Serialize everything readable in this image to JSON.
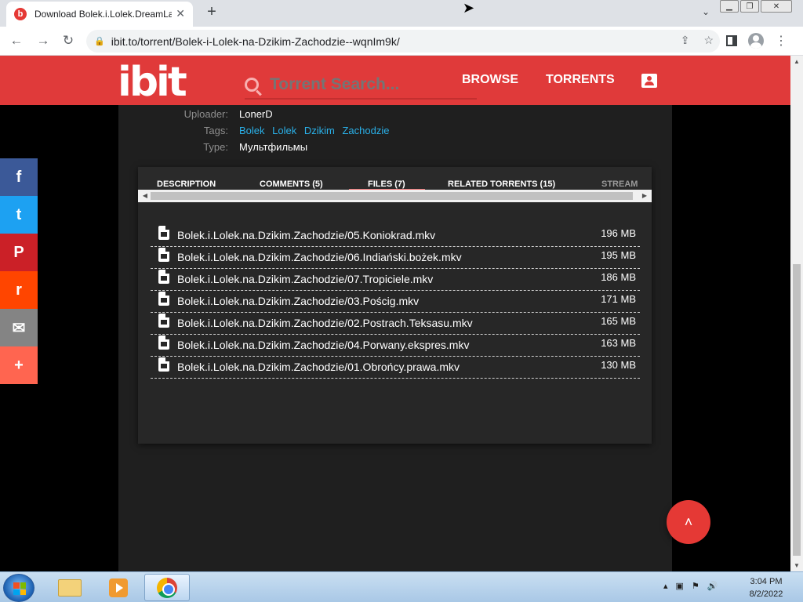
{
  "browser": {
    "tab_title": "Download Bolek.i.Lolek.DreamLa",
    "tab_favicon": "b",
    "close_glyph": "✕",
    "new_tab_glyph": "+",
    "tab_dropdown_glyph": "⌄",
    "window_controls": [
      "▁",
      "❐",
      "✕"
    ],
    "url": "ibit.to/torrent/Bolek-i-Lolek-na-Dzikim-Zachodzie--wqnIm9k/"
  },
  "site": {
    "logo_text": "ibit",
    "search_placeholder": "Torrent Search...",
    "nav": {
      "browse": "BROWSE",
      "torrents": "TORRENTS"
    },
    "accent_color": "#e03a3a"
  },
  "meta": {
    "uploader_label": "Uploader:",
    "uploader": "LonerD",
    "tags_label": "Tags:",
    "tags": [
      "Bolek",
      "Lolek",
      "Dzikim",
      "Zachodzie"
    ],
    "type_label": "Type:",
    "type": "Мультфильмы"
  },
  "tabs": [
    {
      "label": "DESCRIPTION"
    },
    {
      "label": "COMMENTS (5)"
    },
    {
      "label": "FILES (7)"
    },
    {
      "label": "RELATED TORRENTS (15)"
    },
    {
      "label": "STREAM"
    }
  ],
  "files": [
    {
      "name": "Bolek.i.Lolek.na.Dzikim.Zachodzie/05.Koniokrad.mkv",
      "size": "196 MB"
    },
    {
      "name": "Bolek.i.Lolek.na.Dzikim.Zachodzie/06.Indiański.bożek.mkv",
      "size": "195 MB"
    },
    {
      "name": "Bolek.i.Lolek.na.Dzikim.Zachodzie/07.Tropiciele.mkv",
      "size": "186 MB"
    },
    {
      "name": "Bolek.i.Lolek.na.Dzikim.Zachodzie/03.Pościg.mkv",
      "size": "171 MB"
    },
    {
      "name": "Bolek.i.Lolek.na.Dzikim.Zachodzie/02.Postrach.Teksasu.mkv",
      "size": "165 MB"
    },
    {
      "name": "Bolek.i.Lolek.na.Dzikim.Zachodzie/04.Porwany.ekspres.mkv",
      "size": "163 MB"
    },
    {
      "name": "Bolek.i.Lolek.na.Dzikim.Zachodzie/01.Obrońcy.prawa.mkv",
      "size": "130 MB"
    }
  ],
  "social": [
    {
      "icon": "facebook-icon",
      "glyph": "f",
      "color": "#3b5998"
    },
    {
      "icon": "twitter-icon",
      "glyph": "t",
      "color": "#1da1f2"
    },
    {
      "icon": "pinterest-icon",
      "glyph": "P",
      "color": "#cb2027"
    },
    {
      "icon": "reddit-icon",
      "glyph": "r",
      "color": "#ff4500"
    },
    {
      "icon": "email-icon",
      "glyph": "✉",
      "color": "#848484"
    },
    {
      "icon": "share-more-icon",
      "glyph": "+",
      "color": "#ff6550"
    }
  ],
  "scroll_top_glyph": "˄",
  "taskbar": {
    "time": "3:04 PM",
    "date": "8/2/2022",
    "tray_glyphs": [
      "▴",
      "⚑",
      "🔊"
    ]
  }
}
